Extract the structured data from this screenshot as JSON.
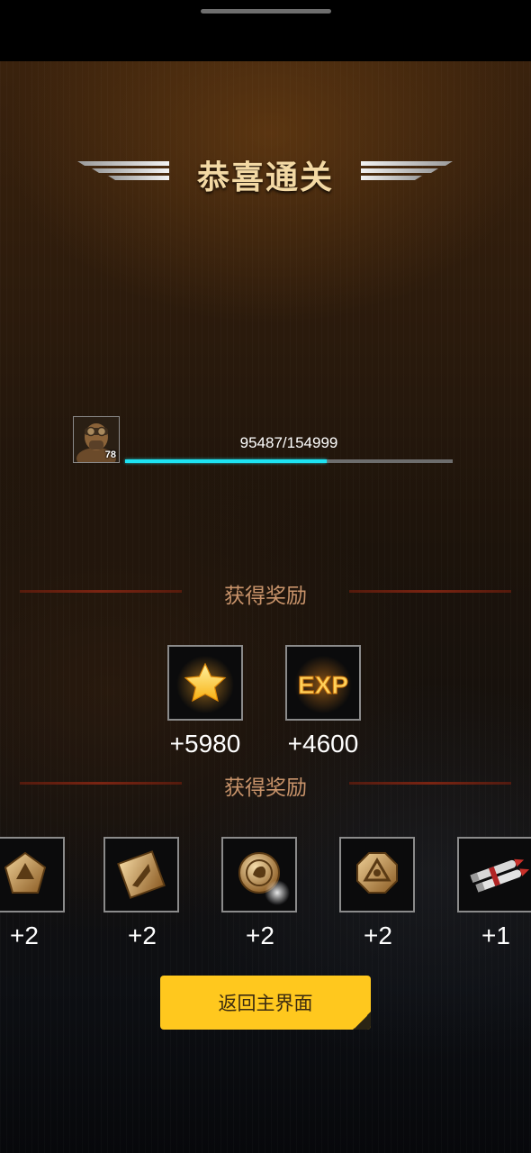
{
  "title": "恭喜通关",
  "player": {
    "level": "78",
    "exp_text": "95487/154999",
    "exp_progress": 0.616
  },
  "rewards_section_1": {
    "header": "获得奖励",
    "items": [
      {
        "icon": "star-icon",
        "amount": "+5980"
      },
      {
        "icon": "exp-icon",
        "icon_text": "EXP",
        "amount": "+4600"
      }
    ]
  },
  "rewards_section_2": {
    "header": "获得奖励",
    "items": [
      {
        "icon": "pentagon-medal-icon",
        "amount": "+2"
      },
      {
        "icon": "diamond-badge-icon",
        "amount": "+2"
      },
      {
        "icon": "round-coin-icon",
        "amount": "+2"
      },
      {
        "icon": "octagon-emblem-icon",
        "amount": "+2"
      },
      {
        "icon": "missile-pod-icon",
        "amount": "+1"
      }
    ]
  },
  "return_button": "返回主界面",
  "colors": {
    "title": "#f3d9a4",
    "section_header": "#c8936a",
    "exp_fill": "#1ee3f3",
    "button": "#ffc81e"
  }
}
